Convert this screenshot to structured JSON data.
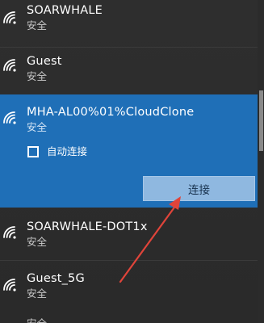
{
  "networks": [
    {
      "ssid": "SOARWHALE",
      "security": "安全"
    },
    {
      "ssid": "Guest",
      "security": "安全"
    },
    {
      "ssid": "MHA-AL00%01%CloudClone",
      "security": "安全"
    },
    {
      "ssid": "SOARWHALE-DOT1x",
      "security": "安全"
    },
    {
      "ssid": "Guest_5G",
      "security": "安全"
    },
    {
      "ssid": "",
      "security": "安全"
    }
  ],
  "expanded": {
    "auto_connect_label": "自动连接",
    "auto_connect_checked": false,
    "connect_label": "连接"
  },
  "colors": {
    "selected_bg": "#1f6fb7",
    "button_bg": "#8fb8e0",
    "annotation_arrow": "#e0443a"
  },
  "icons": {
    "wifi": "wifi-signal-icon",
    "checkbox": "checkbox-icon",
    "annotation": "red-arrow-annotation"
  }
}
